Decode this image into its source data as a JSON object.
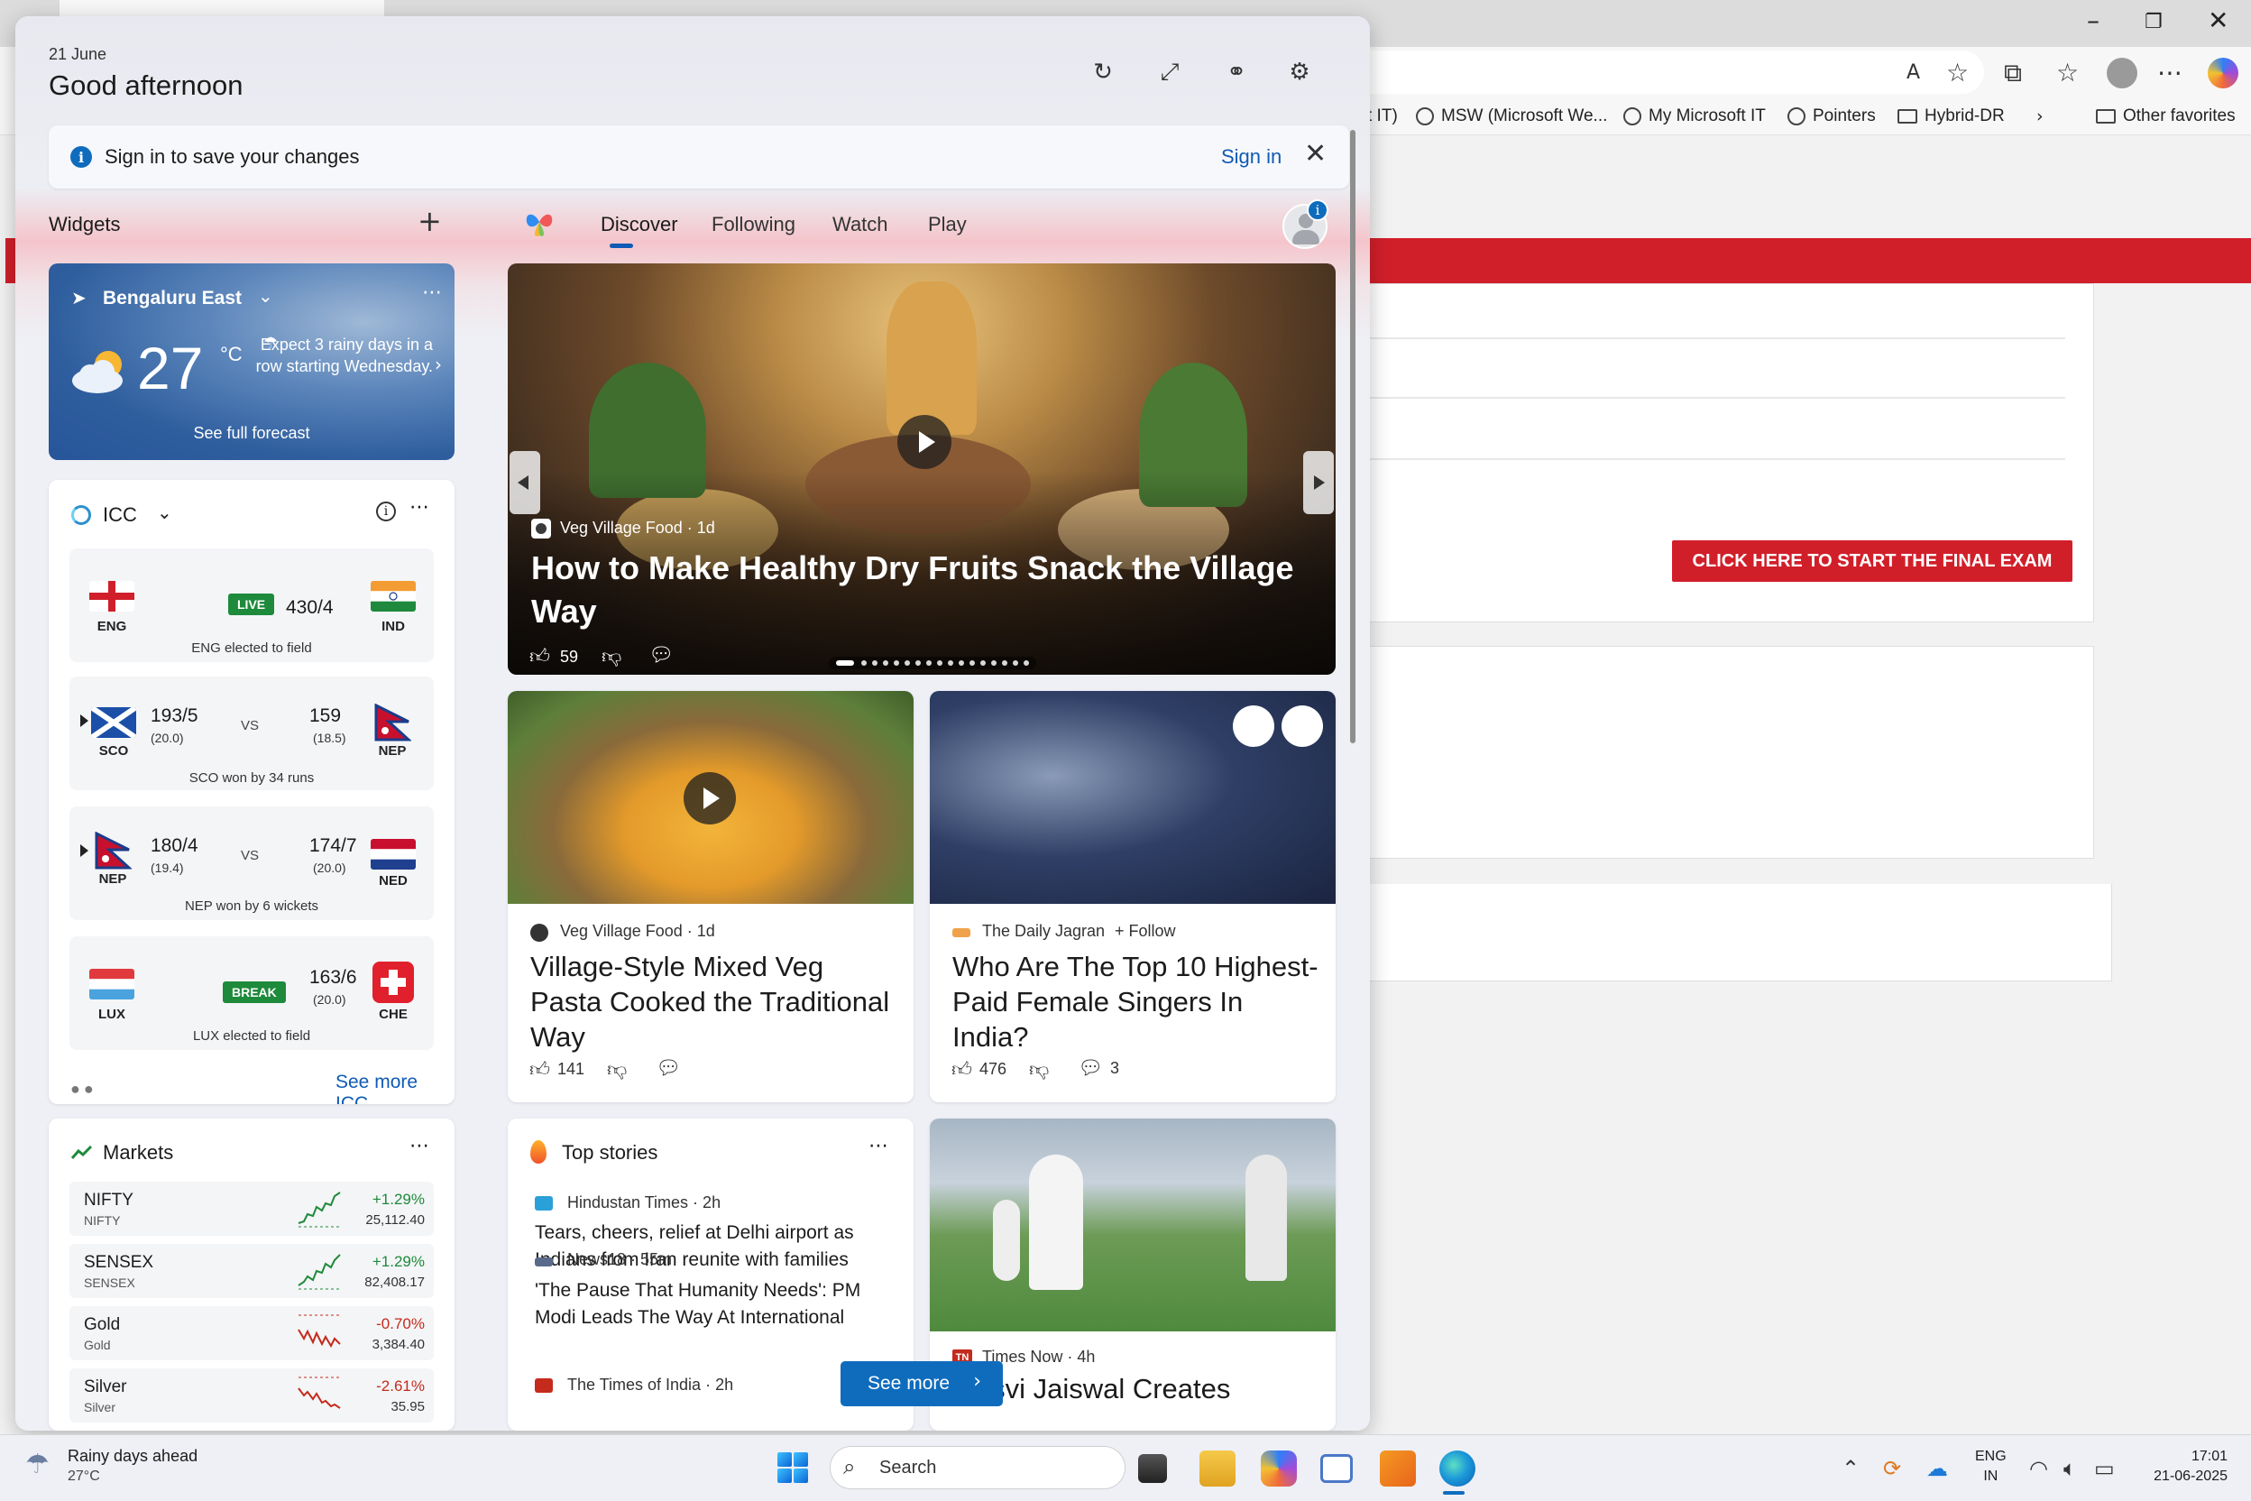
{
  "browser": {
    "favorites": [
      {
        "label": "t IT)"
      },
      {
        "label": "MSW (Microsoft We..."
      },
      {
        "label": "My Microsoft IT"
      },
      {
        "label": "Pointers"
      },
      {
        "label": "Hybrid-DR"
      }
    ],
    "other_favorites": "Other favorites",
    "exam_button": "CLICK HERE TO START THE FINAL EXAM"
  },
  "panel": {
    "date": "21 June",
    "greeting": "Good afternoon",
    "signin_message": "Sign in to save your changes",
    "signin_link": "Sign in",
    "widgets_title": "Widgets",
    "tabs": [
      "Discover",
      "Following",
      "Watch",
      "Play"
    ],
    "active_tab": "Discover"
  },
  "weather": {
    "location": "Bengaluru East",
    "temperature": "27",
    "unit": "°C",
    "summary": "Expect 3 rainy days in a row starting Wednesday.",
    "forecast_link": "See full forecast"
  },
  "icc": {
    "title": "ICC",
    "matches": [
      {
        "team1": "ENG",
        "team2": "IND",
        "status": "LIVE",
        "score2": "430/4",
        "note": "ENG elected to field"
      },
      {
        "team1": "SCO",
        "team2": "NEP",
        "score1": "193/5",
        "overs1": "(20.0)",
        "vs": "VS",
        "score2": "159",
        "overs2": "(18.5)",
        "note": "SCO won by 34 runs"
      },
      {
        "team1": "NEP",
        "team2": "NED",
        "score1": "180/4",
        "overs1": "(19.4)",
        "vs": "VS",
        "score2": "174/7",
        "overs2": "(20.0)",
        "note": "NEP won by 6 wickets"
      },
      {
        "team1": "LUX",
        "team2": "CHE",
        "status": "BREAK",
        "score2": "163/6",
        "overs2": "(20.0)",
        "note": "LUX elected to field"
      }
    ],
    "see_more": "See more ICC"
  },
  "markets": {
    "title": "Markets",
    "rows": [
      {
        "name": "NIFTY",
        "sub": "NIFTY",
        "change": "+1.29%",
        "value": "25,112.40",
        "direction": "up"
      },
      {
        "name": "SENSEX",
        "sub": "SENSEX",
        "change": "+1.29%",
        "value": "82,408.17",
        "direction": "up"
      },
      {
        "name": "Gold",
        "sub": "Gold",
        "change": "-0.70%",
        "value": "3,384.40",
        "direction": "down"
      },
      {
        "name": "Silver",
        "sub": "Silver",
        "change": "-2.61%",
        "value": "35.95",
        "direction": "down"
      }
    ]
  },
  "hero": {
    "source": "Veg Village Food · 1d",
    "title": "How to Make Healthy Dry Fruits Snack the Village Way",
    "likes": "59"
  },
  "articles": [
    {
      "source": "Veg Village Food · 1d",
      "title": "Village-Style Mixed Veg Pasta Cooked the Traditional Way",
      "likes": "141",
      "comments": ""
    },
    {
      "source": "The Daily Jagran",
      "follow": "+ Follow",
      "title": "Who Are The Top 10 Highest-Paid Female Singers In India?",
      "likes": "476",
      "comments": "3"
    }
  ],
  "top_stories": {
    "title": "Top stories",
    "items": [
      {
        "source": "Hindustan Times · 2h",
        "headline": "Tears, cheers, relief at Delhi airport as Indians from Iran reunite with families"
      },
      {
        "source": "News18 · 55m",
        "headline": "'The Pause That Humanity Needs': PM Modi Leads The Way At International"
      },
      {
        "source": "The Times of India · 2h",
        "headline": ""
      }
    ],
    "see_more": "See more"
  },
  "cricket_card": {
    "source": "Times Now · 4h",
    "title": "...asvi Jaiswal Creates"
  },
  "taskbar": {
    "weather_line1": "Rainy days ahead",
    "weather_line2": "27°C",
    "search_placeholder": "Search",
    "lang_1": "ENG",
    "lang_2": "IN",
    "time": "17:01",
    "date": "21-06-2025"
  }
}
